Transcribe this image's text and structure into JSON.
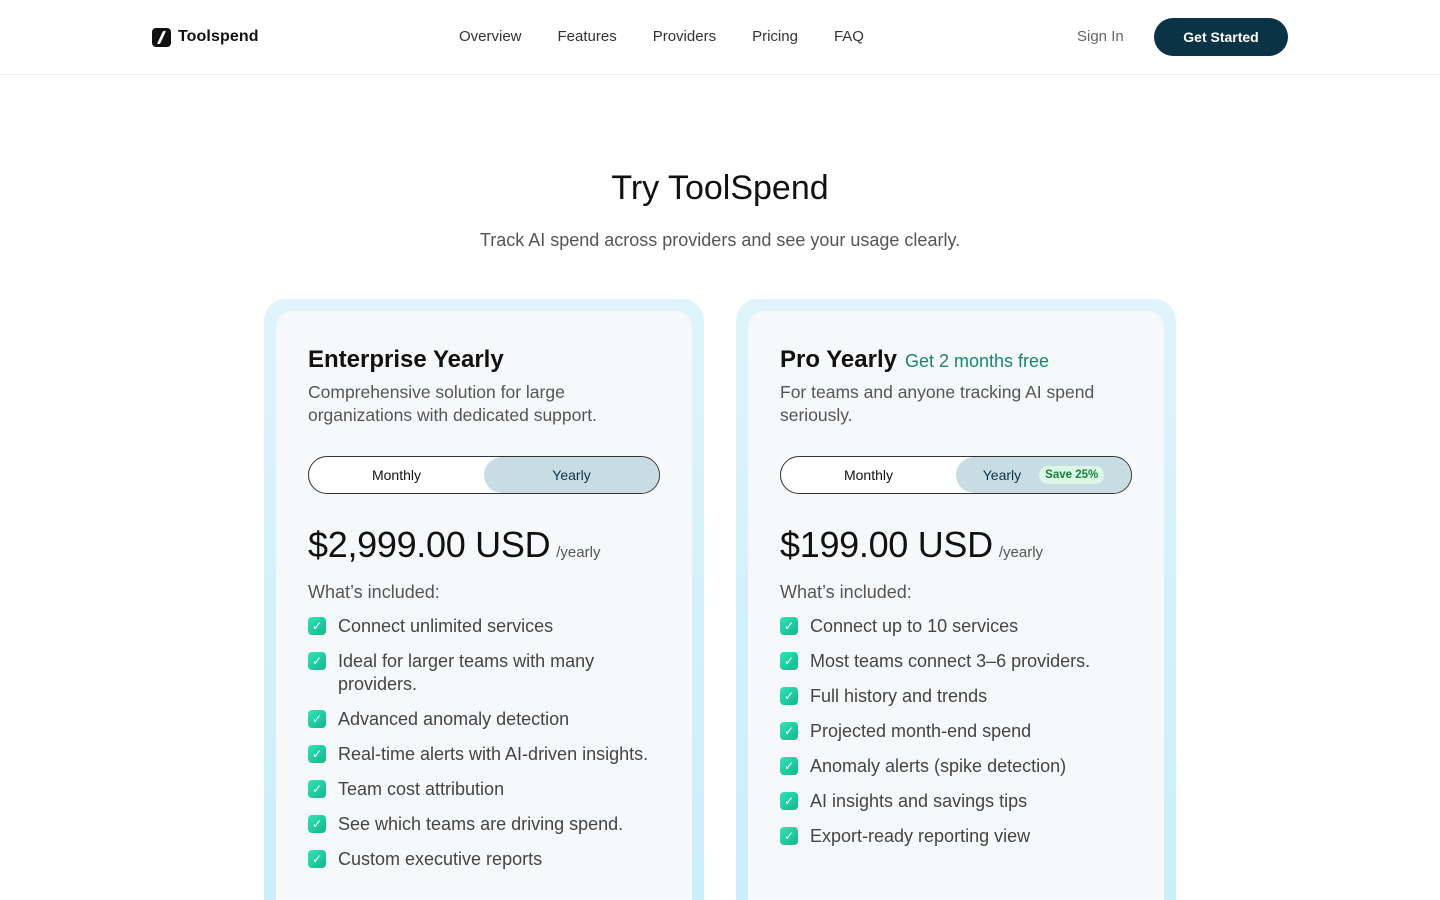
{
  "header": {
    "brand": "Toolspend",
    "nav": [
      "Overview",
      "Features",
      "Providers",
      "Pricing",
      "FAQ"
    ],
    "sign_in": "Sign In",
    "cta": "Get Started"
  },
  "hero": {
    "title": "Try ToolSpend",
    "subtitle": "Track AI spend across providers and see your usage clearly."
  },
  "plans": [
    {
      "title": "Enterprise Yearly",
      "promo": "",
      "description": "Comprehensive solution for large organizations with dedicated support.",
      "toggle": {
        "monthly": "Monthly",
        "yearly": "Yearly",
        "badge": "",
        "selected": "yearly"
      },
      "price": "$2,999.00 USD",
      "period": "/yearly",
      "included_label": "What’s included:",
      "features": [
        "Connect unlimited services",
        "Ideal for larger teams with many providers.",
        "Advanced anomaly detection",
        "Real-time alerts with AI-driven insights.",
        "Team cost attribution",
        "See which teams are driving spend.",
        "Custom executive reports"
      ]
    },
    {
      "title": "Pro Yearly",
      "promo": "Get 2 months free",
      "description": "For teams and anyone tracking AI spend seriously.",
      "toggle": {
        "monthly": "Monthly",
        "yearly": "Yearly",
        "badge": "Save 25%",
        "selected": "yearly"
      },
      "price": "$199.00 USD",
      "period": "/yearly",
      "included_label": "What’s included:",
      "features": [
        "Connect up to 10 services",
        "Most teams connect 3–6 providers.",
        "Full history and trends",
        "Projected month-end spend",
        "Anomaly alerts (spike detection)",
        "AI insights and savings tips",
        "Export-ready reporting view"
      ]
    }
  ],
  "icons": {
    "brand": "toolspend-logo-icon",
    "check": "check-icon"
  },
  "colors": {
    "primary": "#0b3346",
    "accent_green": "#14876f",
    "check": "#12b58c",
    "card_glow": "#d3f1fb"
  }
}
